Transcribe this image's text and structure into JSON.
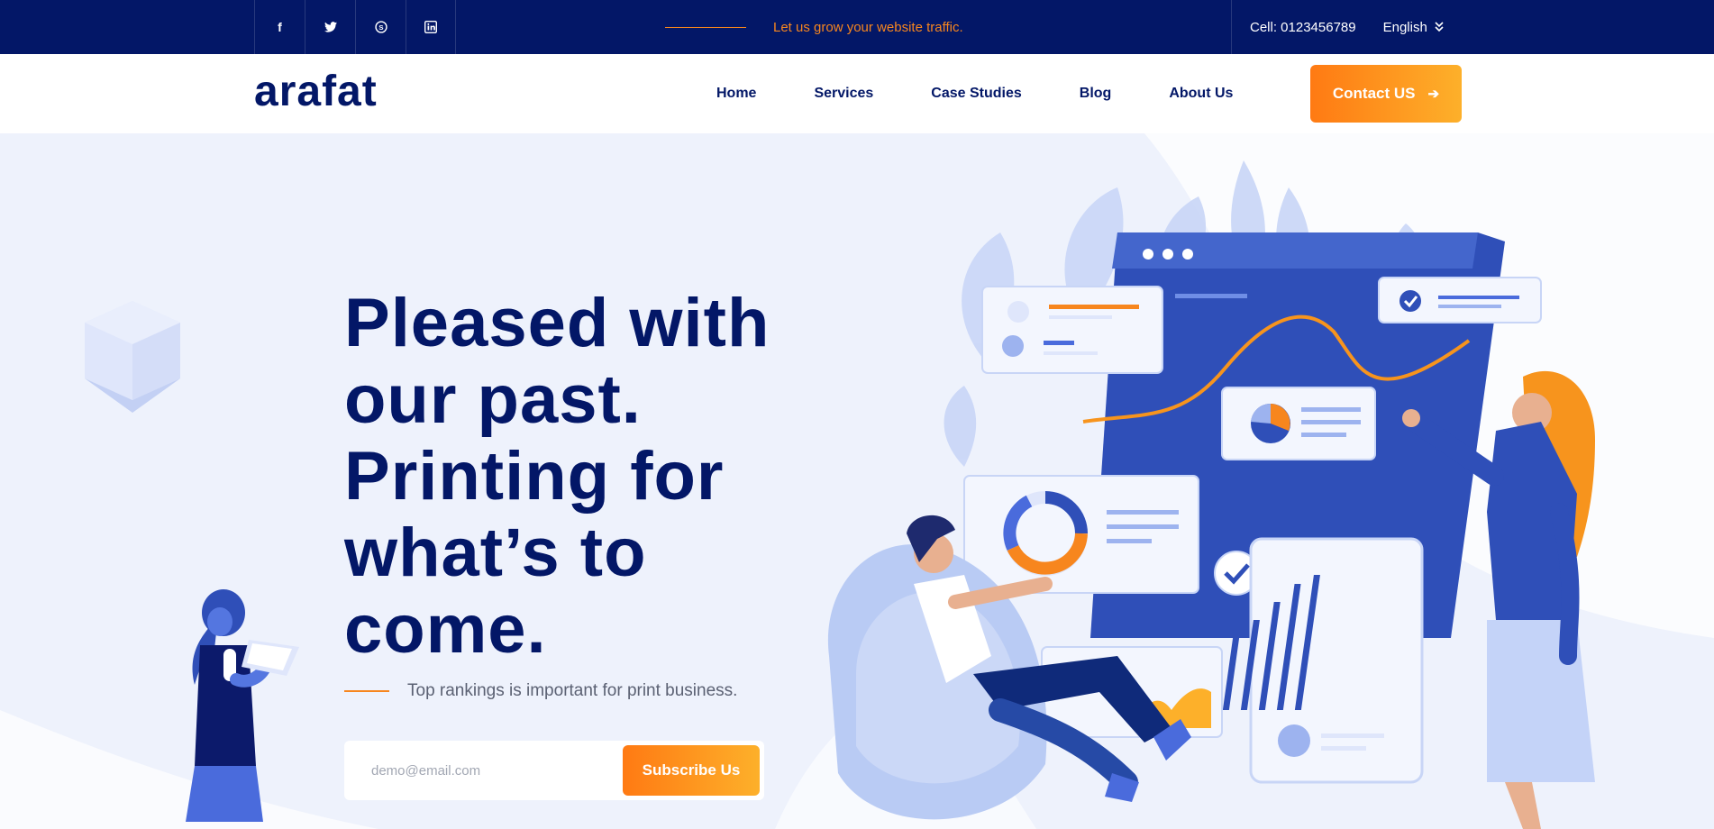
{
  "topbar": {
    "social": [
      {
        "icon": "facebook-icon",
        "glyph": "f"
      },
      {
        "icon": "twitter-icon",
        "glyph": "✧"
      },
      {
        "icon": "skype-icon",
        "glyph": "S"
      },
      {
        "icon": "linkedin-icon",
        "glyph": "in"
      }
    ],
    "tagline": "Let us grow your website traffic.",
    "cell": "Cell: 0123456789",
    "language": "English"
  },
  "header": {
    "logo": "arafat",
    "nav": [
      "Home",
      "Services",
      "Case Studies",
      "Blog",
      "About Us"
    ],
    "contact_label": "Contact US"
  },
  "hero": {
    "headline_lines": [
      "Pleased with",
      "our past.",
      "Printing for",
      "what’s to",
      "come."
    ],
    "subtitle": "Top rankings is important for print business.",
    "email_placeholder": "demo@email.com",
    "subscribe_label": "Subscribe Us"
  },
  "colors": {
    "navy": "#031767",
    "accent_orange": "#f7861e",
    "hero_bg": "#eef2fc",
    "illustration_blue": "#2f4fb8"
  }
}
